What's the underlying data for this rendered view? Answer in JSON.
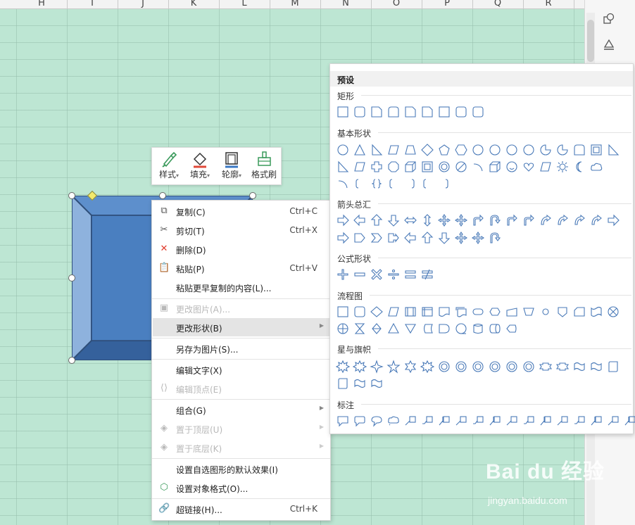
{
  "sheet": {
    "columns": [
      "H",
      "I",
      "J",
      "K",
      "L",
      "M",
      "N",
      "O",
      "P",
      "Q",
      "R"
    ]
  },
  "mini_toolbar": {
    "style_label": "样式",
    "fill_label": "填充",
    "outline_label": "轮廓",
    "format_painter_label": "格式刷"
  },
  "context_menu": {
    "items": [
      {
        "label": "复制(C)",
        "shortcut": "Ctrl+C",
        "icon": "copy-icon"
      },
      {
        "label": "剪切(T)",
        "shortcut": "Ctrl+X",
        "icon": "cut-icon"
      },
      {
        "label": "删除(D)",
        "shortcut": "",
        "icon": "delete-icon"
      },
      {
        "label": "粘贴(P)",
        "shortcut": "Ctrl+V",
        "icon": "paste-icon"
      },
      {
        "label": "粘贴更早复制的内容(L)...",
        "shortcut": "",
        "icon": ""
      },
      {
        "label": "更改图片(A)...",
        "shortcut": "",
        "icon": "change-picture-icon"
      },
      {
        "label": "更改形状(B)",
        "shortcut": "",
        "icon": ""
      },
      {
        "label": "另存为图片(S)...",
        "shortcut": "",
        "icon": ""
      },
      {
        "label": "编辑文字(X)",
        "shortcut": "",
        "icon": ""
      },
      {
        "label": "编辑顶点(E)",
        "shortcut": "",
        "icon": "edit-points-icon"
      },
      {
        "label": "组合(G)",
        "shortcut": "",
        "icon": ""
      },
      {
        "label": "置于顶层(U)",
        "shortcut": "",
        "icon": "bring-front-icon"
      },
      {
        "label": "置于底层(K)",
        "shortcut": "",
        "icon": "send-back-icon"
      },
      {
        "label": "设置自选图形的默认效果(I)",
        "shortcut": "",
        "icon": ""
      },
      {
        "label": "设置对象格式(O)...",
        "shortcut": "",
        "icon": "format-object-icon"
      },
      {
        "label": "超链接(H)...",
        "shortcut": "Ctrl+K",
        "icon": "hyperlink-icon"
      }
    ]
  },
  "shapes_panel": {
    "title": "预设",
    "sections": [
      {
        "label": "矩形"
      },
      {
        "label": "基本形状"
      },
      {
        "label": "箭头总汇"
      },
      {
        "label": "公式形状"
      },
      {
        "label": "流程图"
      },
      {
        "label": "星与旗帜"
      },
      {
        "label": "标注"
      }
    ]
  },
  "watermark": {
    "brand": "Bai du 经验",
    "url": "jingyan.baidu.com"
  },
  "colors": {
    "sheet_bg": "#bde6d3",
    "shape_fill": "#4a7fc0",
    "shape_stroke": "#2f4f7a",
    "icon_blue": "#4a7ab8",
    "menu_highlight": "#e4e4e4"
  }
}
